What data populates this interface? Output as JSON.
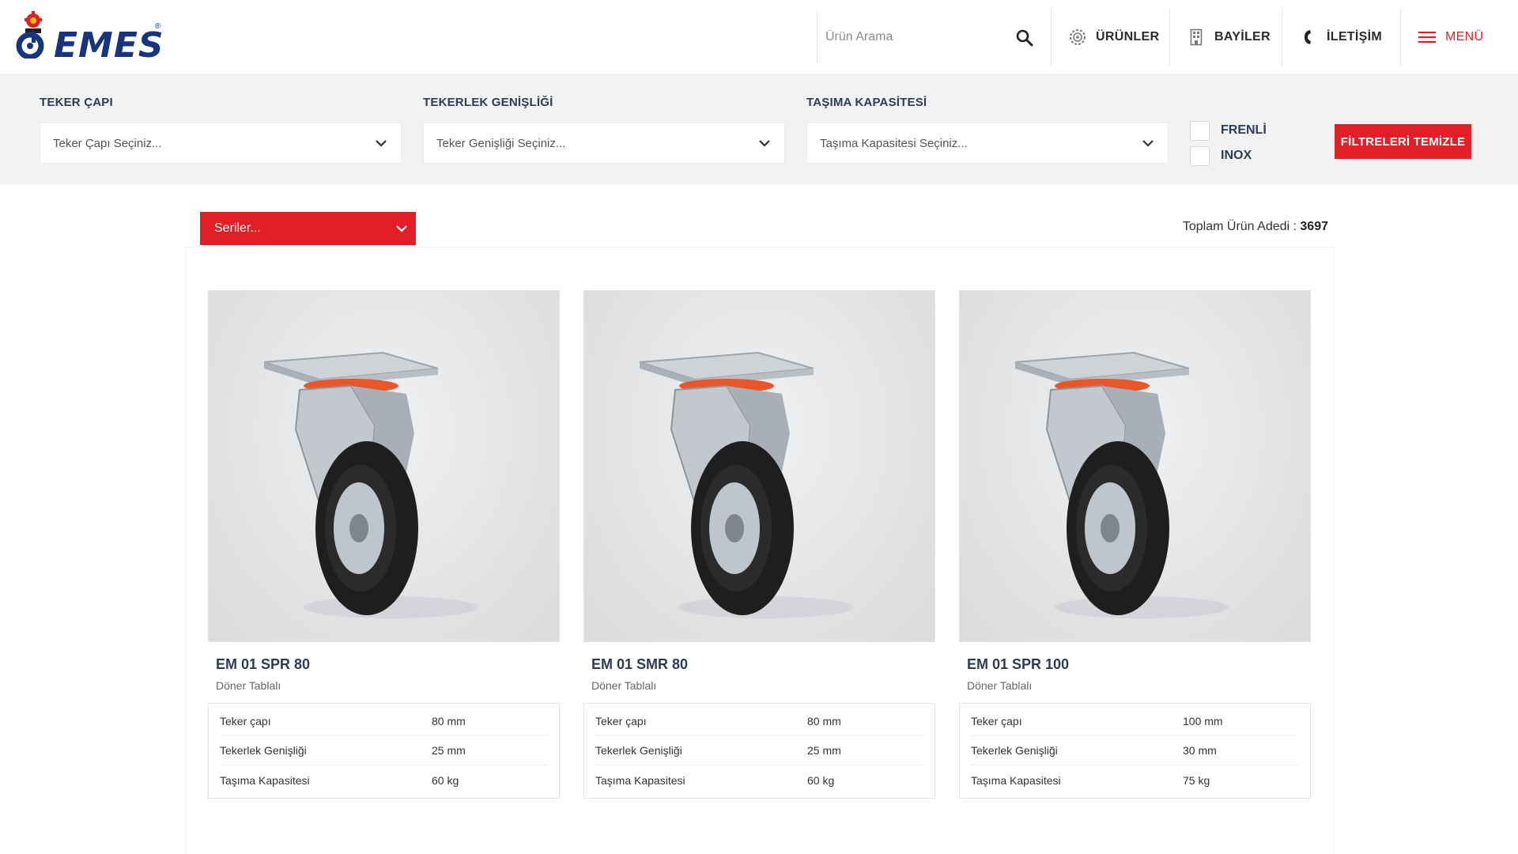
{
  "brand": {
    "name": "EMES",
    "accent": "#e21f26",
    "navy": "#17357d"
  },
  "header": {
    "search_placeholder": "Ürün Arama",
    "nav": {
      "urunler": "ÜRÜNLER",
      "bayiler": "BAYİLER",
      "iletisim": "İLETİŞİM",
      "menu": "MENÜ"
    }
  },
  "filters": {
    "teker_capi": {
      "label": "TEKER ÇAPI",
      "placeholder": "Teker Çapı Seçiniz..."
    },
    "tekerlek_genisligi": {
      "label": "TEKERLEK GENİŞLİĞİ",
      "placeholder": "Teker Genişliği Seçiniz..."
    },
    "tasima_kapasitesi": {
      "label": "TAŞIMA KAPASİTESİ",
      "placeholder": "Taşıma Kapasitesi Seçiniz..."
    },
    "checks": {
      "frenli": "FRENLİ",
      "inox": "INOX"
    },
    "clear_label": "FİLTRELERİ TEMİZLE"
  },
  "toolbar": {
    "series_label": "Seriler...",
    "total_label": "Toplam Ürün Adedi :",
    "total_count": "3697"
  },
  "products": [
    {
      "name": "EM 01 SPR 80",
      "type": "Döner Tablalı",
      "specs": [
        {
          "key": "Teker çapı",
          "value": "80 mm"
        },
        {
          "key": "Tekerlek Genişliği",
          "value": "25 mm"
        },
        {
          "key": "Taşıma Kapasitesi",
          "value": "60 kg"
        }
      ]
    },
    {
      "name": "EM 01 SMR 80",
      "type": "Döner Tablalı",
      "specs": [
        {
          "key": "Teker çapı",
          "value": "80 mm"
        },
        {
          "key": "Tekerlek Genişliği",
          "value": "25 mm"
        },
        {
          "key": "Taşıma Kapasitesi",
          "value": "60 kg"
        }
      ]
    },
    {
      "name": "EM 01 SPR 100",
      "type": "Döner Tablalı",
      "specs": [
        {
          "key": "Teker çapı",
          "value": "100 mm"
        },
        {
          "key": "Tekerlek Genişliği",
          "value": "30 mm"
        },
        {
          "key": "Taşıma Kapasitesi",
          "value": "75 kg"
        }
      ]
    }
  ]
}
